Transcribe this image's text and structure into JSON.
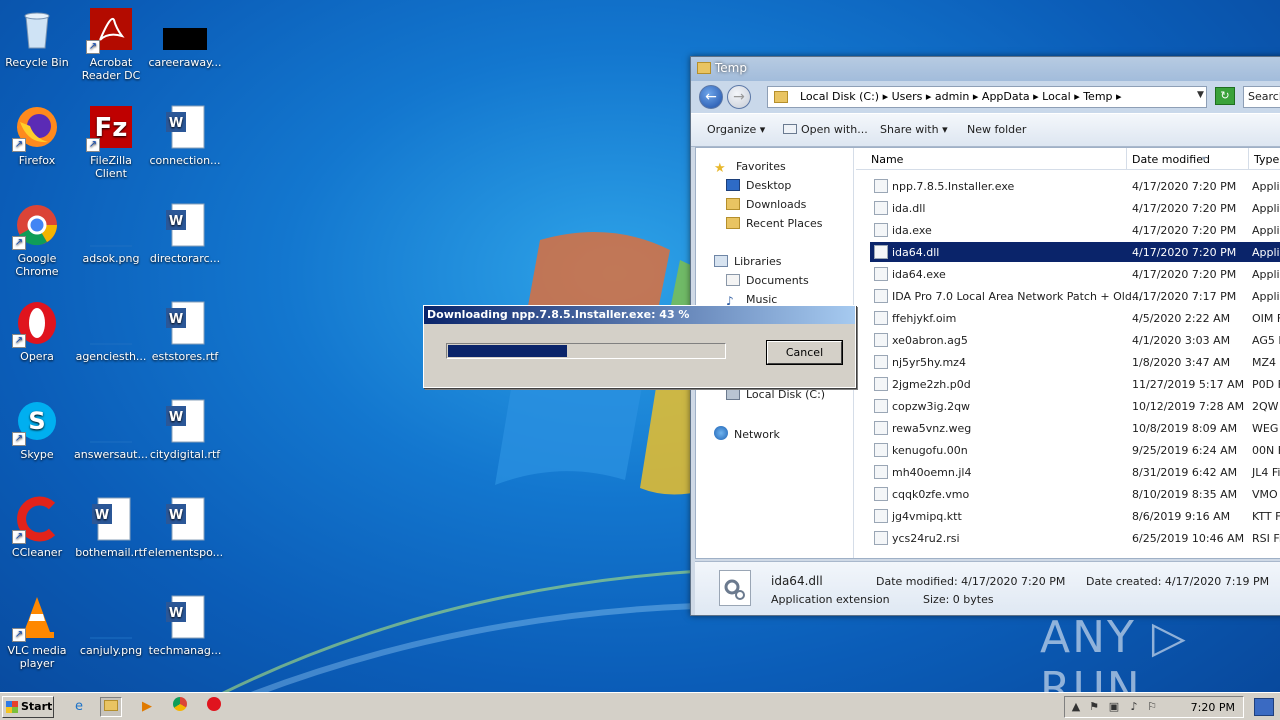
{
  "desktop": {
    "icons": [
      {
        "label": "Recycle Bin"
      },
      {
        "label": "Acrobat Reader DC"
      },
      {
        "label": "careeraway..."
      },
      {
        "label": "Firefox"
      },
      {
        "label": "FileZilla Client"
      },
      {
        "label": "connection..."
      },
      {
        "label": "Google Chrome"
      },
      {
        "label": "adsok.png"
      },
      {
        "label": "directorarc..."
      },
      {
        "label": "Opera"
      },
      {
        "label": "agenciesth..."
      },
      {
        "label": "eststores.rtf"
      },
      {
        "label": "Skype"
      },
      {
        "label": "answersaut..."
      },
      {
        "label": "citydigital.rtf"
      },
      {
        "label": "CCleaner"
      },
      {
        "label": "bothemail.rtf"
      },
      {
        "label": "elementspo..."
      },
      {
        "label": "VLC media player"
      },
      {
        "label": "canjuly.png"
      },
      {
        "label": "techmanag..."
      }
    ]
  },
  "explorer": {
    "title": "Temp",
    "address": "Local Disk (C:)  ▸  Users  ▸  admin  ▸  AppData  ▸  Local  ▸  Temp  ▸",
    "search_placeholder": "Search",
    "toolbar": {
      "organize": "Organize ▾",
      "open_with": "Open with...",
      "share_with": "Share with ▾",
      "new_folder": "New folder"
    },
    "nav": {
      "favorites": "Favorites",
      "desktop": "Desktop",
      "downloads": "Downloads",
      "recent": "Recent Places",
      "libraries": "Libraries",
      "documents": "Documents",
      "music": "Music",
      "local_disk": "Local Disk (C:)",
      "network": "Network"
    },
    "columns": {
      "name": "Name",
      "date": "Date modified",
      "type": "Type"
    },
    "files": [
      {
        "name": "npp.7.8.5.Installer.exe",
        "date": "4/17/2020 7:20 PM",
        "type": "Applic"
      },
      {
        "name": "ida.dll",
        "date": "4/17/2020 7:20 PM",
        "type": "Applic"
      },
      {
        "name": "ida.exe",
        "date": "4/17/2020 7:20 PM",
        "type": "Applic"
      },
      {
        "name": "ida64.dll",
        "date": "4/17/2020 7:20 PM",
        "type": "Applic"
      },
      {
        "name": "ida64.exe",
        "date": "4/17/2020 7:20 PM",
        "type": "Applic"
      },
      {
        "name": "IDA Pro 7.0 Local  Area Network Patch + Old...",
        "date": "4/17/2020 7:17 PM",
        "type": "Applic"
      },
      {
        "name": "ffehjykf.oim",
        "date": "4/5/2020 2:22 AM",
        "type": "OIM F"
      },
      {
        "name": "xe0abron.ag5",
        "date": "4/1/2020 3:03 AM",
        "type": "AG5 F"
      },
      {
        "name": "nj5yr5hy.mz4",
        "date": "1/8/2020 3:47 AM",
        "type": "MZ4 F"
      },
      {
        "name": "2jgme2zh.p0d",
        "date": "11/27/2019 5:17 AM",
        "type": "P0D F"
      },
      {
        "name": "copzw3ig.2qw",
        "date": "10/12/2019 7:28 AM",
        "type": "2QW F"
      },
      {
        "name": "rewa5vnz.weg",
        "date": "10/8/2019 8:09 AM",
        "type": "WEG F"
      },
      {
        "name": "kenugofu.00n",
        "date": "9/25/2019 6:24 AM",
        "type": "00N F"
      },
      {
        "name": "mh40oemn.jl4",
        "date": "8/31/2019 6:42 AM",
        "type": "JL4 Fil"
      },
      {
        "name": "cqqk0zfe.vmo",
        "date": "8/10/2019 8:35 AM",
        "type": "VMO F"
      },
      {
        "name": "jg4vmipq.ktt",
        "date": "8/6/2019 9:16 AM",
        "type": "KTT Fi"
      },
      {
        "name": "ycs24ru2.rsi",
        "date": "6/25/2019 10:46 AM",
        "type": "RSI Fi"
      }
    ],
    "selected_index": 3,
    "details": {
      "name": "ida64.dll",
      "kind": "Application extension",
      "modified": "Date modified:  4/17/2020 7:20 PM",
      "size": "Size:  0 bytes",
      "created": "Date created:  4/17/2020 7:19 PM"
    }
  },
  "download_dialog": {
    "title": "Downloading npp.7.8.5.Installer.exe: 43 %",
    "progress": 0.43,
    "cancel": "Cancel"
  },
  "taskbar": {
    "start": "Start",
    "clock": "7:20 PM"
  },
  "watermark": "ANY ▷ RUN"
}
